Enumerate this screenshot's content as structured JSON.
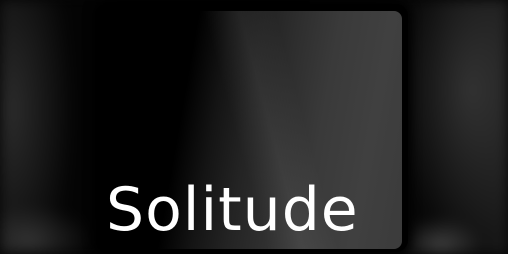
{
  "title": "Solitude",
  "colors": {
    "background": "#000000",
    "card": "#3a3a3a",
    "text": "#ffffff"
  }
}
